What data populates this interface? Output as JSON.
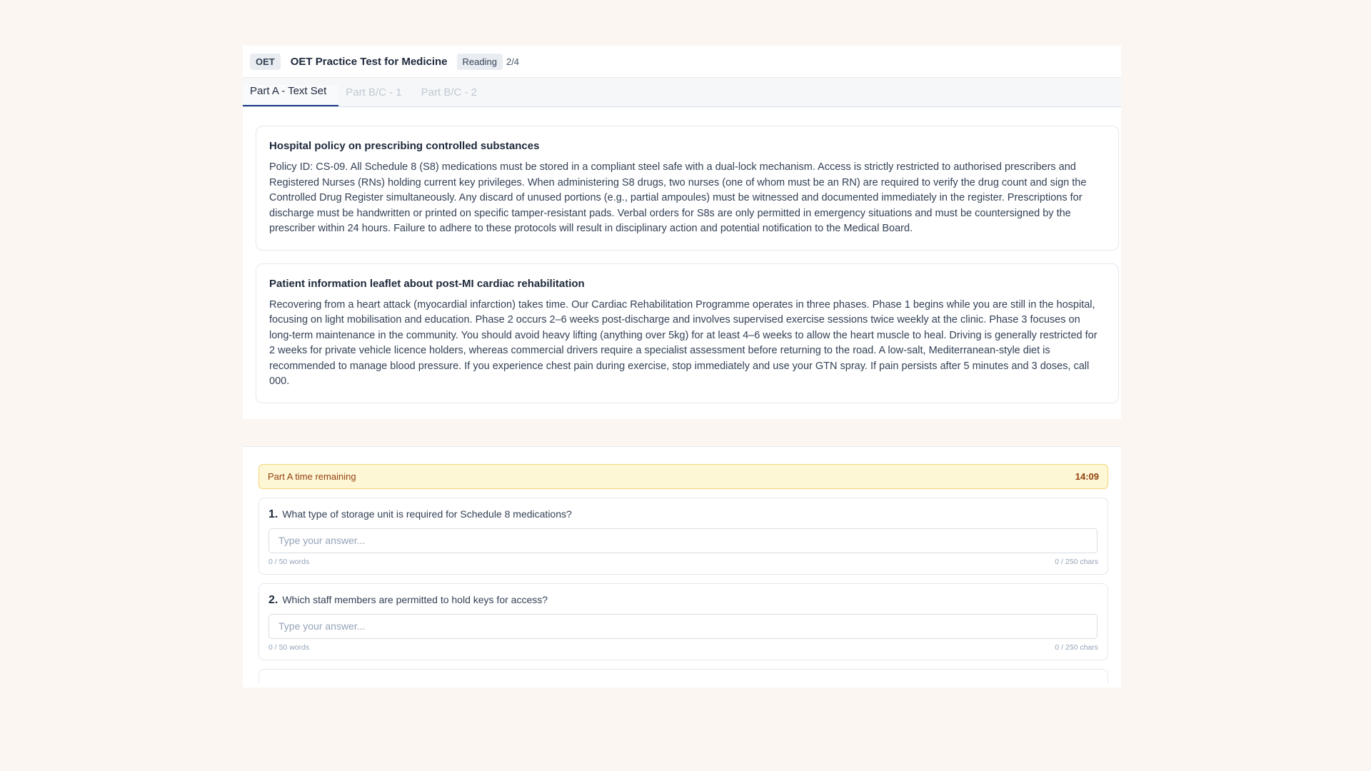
{
  "header": {
    "badge": "OET",
    "title": "OET Practice Test for Medicine",
    "section": "Reading",
    "progress": "2/4"
  },
  "tabs": [
    {
      "label": "Part A - Text Set",
      "active": true
    },
    {
      "label": "Part B/C - 1",
      "active": false
    },
    {
      "label": "Part B/C - 2",
      "active": false
    }
  ],
  "texts": [
    {
      "title": "Hospital policy on prescribing controlled substances",
      "body": "Policy ID: CS-09. All Schedule 8 (S8) medications must be stored in a compliant steel safe with a dual-lock mechanism. Access is strictly restricted to authorised prescribers and Registered Nurses (RNs) holding current key privileges. When administering S8 drugs, two nurses (one of whom must be an RN) are required to verify the drug count and sign the Controlled Drug Register simultaneously. Any discard of unused portions (e.g., partial ampoules) must be witnessed and documented immediately in the register. Prescriptions for discharge must be handwritten or printed on specific tamper-resistant pads. Verbal orders for S8s are only permitted in emergency situations and must be countersigned by the prescriber within 24 hours. Failure to adhere to these protocols will result in disciplinary action and potential notification to the Medical Board."
    },
    {
      "title": "Patient information leaflet about post-MI cardiac rehabilitation",
      "body": "Recovering from a heart attack (myocardial infarction) takes time. Our Cardiac Rehabilitation Programme operates in three phases. Phase 1 begins while you are still in the hospital, focusing on light mobilisation and education. Phase 2 occurs 2–6 weeks post-discharge and involves supervised exercise sessions twice weekly at the clinic. Phase 3 focuses on long-term maintenance in the community. You should avoid heavy lifting (anything over 5kg) for at least 4–6 weeks to allow the heart muscle to heal. Driving is generally restricted for 2 weeks for private vehicle licence holders, whereas commercial drivers require a specialist assessment before returning to the road. A low-salt, Mediterranean-style diet is recommended to manage blood pressure. If you experience chest pain during exercise, stop immediately and use your GTN spray. If pain persists after 5 minutes and 3 doses, call 000."
    }
  ],
  "timer": {
    "label": "Part A time remaining",
    "value": "14:09"
  },
  "questions": [
    {
      "number": "1.",
      "text": "What type of storage unit is required for Schedule 8 medications?",
      "placeholder": "Type your answer...",
      "value": "",
      "word_count": "0 / 50 words",
      "char_count": "0 / 250 chars"
    },
    {
      "number": "2.",
      "text": "Which staff members are permitted to hold keys for access?",
      "placeholder": "Type your answer...",
      "value": "",
      "word_count": "0 / 50 words",
      "char_count": "0 / 250 chars"
    }
  ],
  "colors": {
    "background": "#fcf6f2",
    "tab_active_underline": "#1e3a8a",
    "timer_bg": "#fef7d6",
    "timer_text": "#92400e"
  }
}
